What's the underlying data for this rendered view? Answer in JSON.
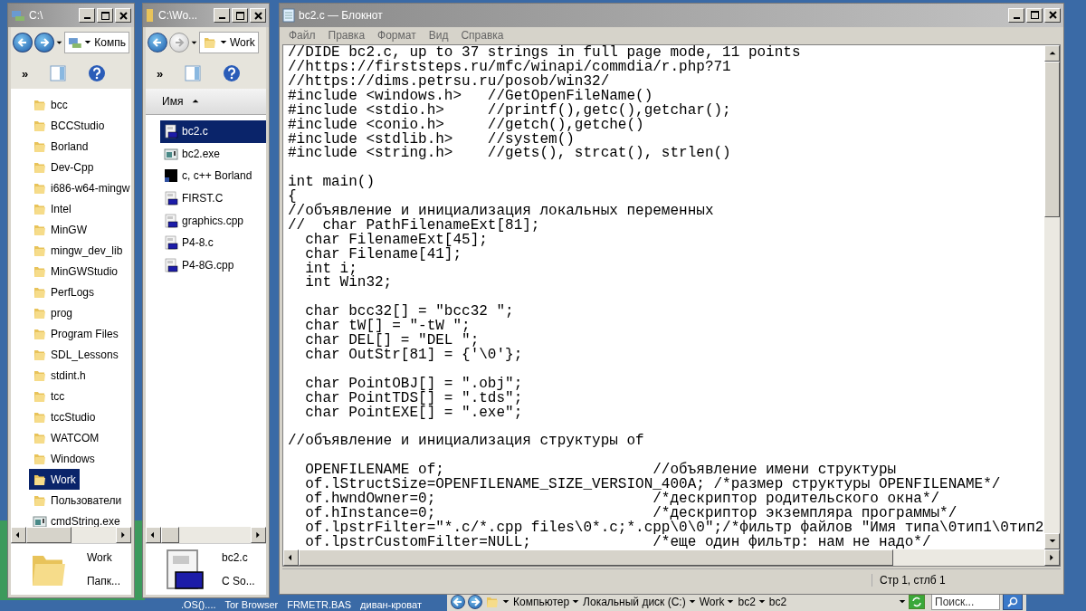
{
  "explorers": [
    {
      "title": "C:\\",
      "address": "Компь",
      "forward_enabled": true,
      "more": "»",
      "items": [
        {
          "name": "bcc",
          "kind": "folder",
          "selected": false
        },
        {
          "name": "BCCStudio",
          "kind": "folder",
          "selected": false
        },
        {
          "name": "Borland",
          "kind": "folder",
          "selected": false
        },
        {
          "name": "Dev-Cpp",
          "kind": "folder",
          "selected": false
        },
        {
          "name": "i686-w64-mingw",
          "kind": "folder",
          "selected": false
        },
        {
          "name": "Intel",
          "kind": "folder",
          "selected": false
        },
        {
          "name": "MinGW",
          "kind": "folder",
          "selected": false
        },
        {
          "name": "mingw_dev_lib",
          "kind": "folder",
          "selected": false
        },
        {
          "name": "MinGWStudio",
          "kind": "folder",
          "selected": false
        },
        {
          "name": "PerfLogs",
          "kind": "folder",
          "selected": false
        },
        {
          "name": "prog",
          "kind": "folder",
          "selected": false
        },
        {
          "name": "Program Files",
          "kind": "folder",
          "selected": false
        },
        {
          "name": "SDL_Lessons",
          "kind": "folder",
          "selected": false
        },
        {
          "name": "stdint.h",
          "kind": "folder",
          "selected": false
        },
        {
          "name": "tcc",
          "kind": "folder",
          "selected": false
        },
        {
          "name": "tccStudio",
          "kind": "folder",
          "selected": false
        },
        {
          "name": "WATCOM",
          "kind": "folder",
          "selected": false
        },
        {
          "name": "Windows",
          "kind": "folder",
          "selected": false
        },
        {
          "name": "Work",
          "kind": "folder",
          "selected": true
        },
        {
          "name": "Пользователи",
          "kind": "folder",
          "selected": false
        },
        {
          "name": "cmdString.exe",
          "kind": "exe",
          "selected": false
        }
      ],
      "details": {
        "kind": "folder",
        "name": "Work",
        "type": "Папк..."
      }
    },
    {
      "title": "C:\\Wo...",
      "address": "Work",
      "forward_enabled": false,
      "more": "»",
      "column": "Имя",
      "items": [
        {
          "name": "bc2.c",
          "kind": "c",
          "selected": true
        },
        {
          "name": "bc2.exe",
          "kind": "exe",
          "selected": false
        },
        {
          "name": "c, c++   Borland",
          "kind": "shortcut",
          "selected": false
        },
        {
          "name": "FIRST.C",
          "kind": "c",
          "selected": false
        },
        {
          "name": "graphics.cpp",
          "kind": "cpp",
          "selected": false
        },
        {
          "name": "P4-8.c",
          "kind": "c",
          "selected": false
        },
        {
          "name": "P4-8G.cpp",
          "kind": "cpp",
          "selected": false
        }
      ],
      "details": {
        "kind": "c",
        "name": "bc2.c",
        "type": "C So..."
      }
    }
  ],
  "notepad": {
    "title": "bc2.c — Блокнот",
    "menu": [
      "Файл",
      "Правка",
      "Формат",
      "Вид",
      "Справка"
    ],
    "code_blocks": [
      [
        "//DIDE bc2.c, up to 37 strings in full page mode, 11 points",
        "//https://firststeps.ru/mfc/winapi/commdia/r.php?71",
        "//https://dims.petrsu.ru/posob/win32/",
        "#include <windows.h>   //GetOpenFileName()",
        "#include <stdio.h>     //printf(),getc(),getchar();",
        "#include <conio.h>     //getch(),getche()",
        "#include <stdlib.h>    //system()",
        "#include <string.h>    //gets(), strcat(), strlen()"
      ],
      [
        "int main()",
        "{",
        "//объявление и инициализация локальных переменных",
        "//  char PathFilenameExt[81];",
        "  char FilenameExt[45];",
        "  char Filename[41];",
        "  int i;",
        "  int Win32;"
      ],
      [
        "  char bcc32[] = \"bcc32 \";",
        "  char tW[] = \"-tW \";",
        "  char DEL[] = \"DEL \";",
        "  char OutStr[81] = {'\\0'};"
      ],
      [
        "  char PointOBJ[] = \".obj\";",
        "  char PointTDS[] = \".tds\";",
        "  char PointEXE[] = \".exe\";"
      ],
      [
        "//объявление и инициализация структуры of"
      ],
      [
        "  OPENFILENAME of;                        //объявление имени структуры",
        "  of.lStructSize=OPENFILENAME_SIZE_VERSION_400A; /*размер структуры OPENFILENAME*/",
        "  of.hwndOwner=0;                         /*дескриптор родительского окна*/",
        "  of.hInstance=0;                         /*дескриптор экземпляра программы*/",
        "  of.lpstrFilter=\"*.c/*.cpp files\\0*.c;*.cpp\\0\\0\";/*фильтр файлов \"Имя типа\\0тип1\\0тип2",
        "  of.lpstrCustomFilter=NULL;              /*еще один фильтр: нам не надо*/"
      ]
    ],
    "status": "Стр 1, стлб 1"
  },
  "desktop_labels": [
    ".OS()....",
    "Tor Browser",
    "FRMETR.BAS",
    "диван-кроват"
  ],
  "background_explorer": {
    "breadcrumbs": [
      "Компьютер",
      "Локальный диск (C:)",
      "Work",
      "bc2",
      "bc2"
    ],
    "search_placeholder": "Поиск..."
  }
}
